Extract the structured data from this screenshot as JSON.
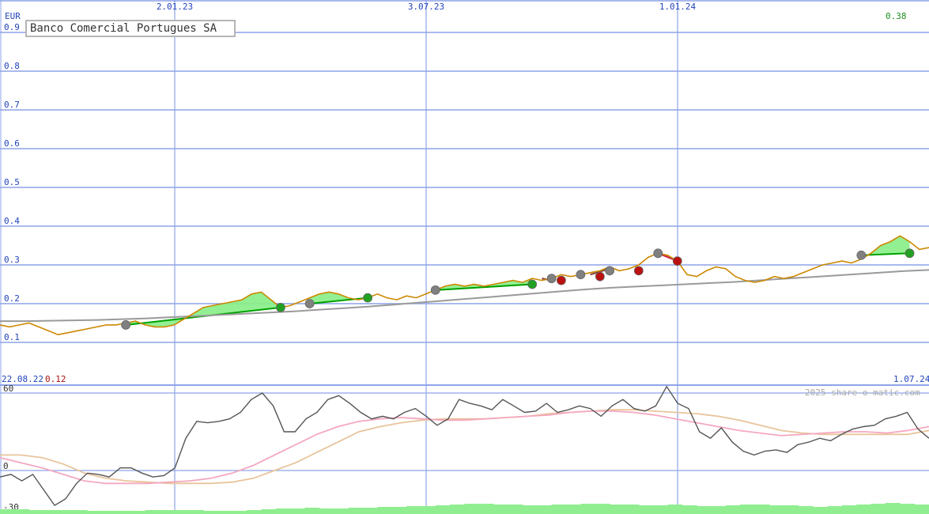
{
  "title": "Banco Comercial Portugues SA",
  "currency": "EUR",
  "last_value": "0.38",
  "watermark": "2025 share-o-matic.com",
  "period": {
    "start": "22.08.22",
    "end": "1.07.24",
    "start_value": "0.12"
  },
  "colors": {
    "grid": "#8ea4e8",
    "price": "#cc8800",
    "long_ma": "#9a9a9a",
    "trend_up": "#00a000",
    "fill_up": "#86ee86",
    "fill_down": "#ff9fb8",
    "marker_grey": "#808080",
    "marker_green": "#22a022",
    "marker_red": "#bb1111",
    "osc": "#555555",
    "osc_pink": "#f4a8c0",
    "osc_tan": "#e8c49c",
    "volume": "#90ee90"
  },
  "chart_data": [
    {
      "type": "line",
      "title": "Banco Comercial Portugues SA",
      "ylabel": "EUR",
      "x_ticks": [
        "2.01.23",
        "3.07.23",
        "1.01.24"
      ],
      "y_ticks": [
        "0.1",
        "0.2",
        "0.3",
        "0.4",
        "0.5",
        "0.6",
        "0.7",
        "0.8",
        "0.9"
      ],
      "ylim": [
        0.09,
        0.93
      ],
      "grid": true,
      "series": [
        {
          "role": "price",
          "values": [
            0.145,
            0.14,
            0.145,
            0.15,
            0.14,
            0.13,
            0.12,
            0.125,
            0.13,
            0.135,
            0.14,
            0.145,
            0.145,
            0.15,
            0.155,
            0.145,
            0.14,
            0.14,
            0.145,
            0.16,
            0.175,
            0.19,
            0.195,
            0.2,
            0.205,
            0.21,
            0.225,
            0.23,
            0.21,
            0.19,
            0.195,
            0.205,
            0.215,
            0.225,
            0.23,
            0.225,
            0.215,
            0.21,
            0.215,
            0.225,
            0.215,
            0.21,
            0.22,
            0.215,
            0.225,
            0.235,
            0.245,
            0.25,
            0.245,
            0.25,
            0.245,
            0.25,
            0.255,
            0.26,
            0.255,
            0.265,
            0.26,
            0.265,
            0.275,
            0.27,
            0.275,
            0.28,
            0.285,
            0.295,
            0.285,
            0.29,
            0.3,
            0.32,
            0.33,
            0.325,
            0.31,
            0.275,
            0.27,
            0.285,
            0.295,
            0.29,
            0.27,
            0.26,
            0.255,
            0.26,
            0.27,
            0.265,
            0.27,
            0.28,
            0.29,
            0.3,
            0.305,
            0.31,
            0.305,
            0.315,
            0.33,
            0.35,
            0.36,
            0.375,
            0.36,
            0.34,
            0.345
          ]
        },
        {
          "role": "long moving average",
          "values": [
            0.155,
            0.155,
            0.156,
            0.157,
            0.158,
            0.16,
            0.162,
            0.165,
            0.168,
            0.171,
            0.174,
            0.177,
            0.18,
            0.184,
            0.188,
            0.192,
            0.197,
            0.202,
            0.207,
            0.212,
            0.217,
            0.222,
            0.227,
            0.232,
            0.237,
            0.241,
            0.244,
            0.247,
            0.25,
            0.253,
            0.256,
            0.26,
            0.264,
            0.268,
            0.272,
            0.276,
            0.28,
            0.284,
            0.287
          ]
        }
      ],
      "trend_segments": [
        {
          "from": 0.145,
          "to": 0.19,
          "dir": "up"
        },
        {
          "from": 0.2,
          "to": 0.215,
          "dir": "up"
        },
        {
          "from": 0.235,
          "to": 0.25,
          "dir": "up"
        },
        {
          "from": 0.265,
          "to": 0.26,
          "dir": "mixed"
        },
        {
          "from": 0.275,
          "to": 0.29,
          "dir": "mixed"
        },
        {
          "from": 0.33,
          "to": 0.31,
          "dir": "down"
        },
        {
          "from": 0.325,
          "to": 0.33,
          "dir": "up"
        }
      ],
      "signals": [
        {
          "y": 0.145,
          "kind": "grey"
        },
        {
          "y": 0.19,
          "kind": "green"
        },
        {
          "y": 0.2,
          "kind": "grey"
        },
        {
          "y": 0.215,
          "kind": "green"
        },
        {
          "y": 0.235,
          "kind": "grey"
        },
        {
          "y": 0.25,
          "kind": "green"
        },
        {
          "y": 0.265,
          "kind": "grey"
        },
        {
          "y": 0.26,
          "kind": "red"
        },
        {
          "y": 0.275,
          "kind": "grey"
        },
        {
          "y": 0.27,
          "kind": "red"
        },
        {
          "y": 0.285,
          "kind": "grey"
        },
        {
          "y": 0.285,
          "kind": "red"
        },
        {
          "y": 0.33,
          "kind": "grey"
        },
        {
          "y": 0.31,
          "kind": "red"
        },
        {
          "y": 0.325,
          "kind": "grey"
        },
        {
          "y": 0.33,
          "kind": "green"
        }
      ]
    },
    {
      "type": "line",
      "y_ticks": [
        "60",
        "0",
        "-30"
      ],
      "ylim": [
        -30,
        60
      ],
      "grid": true,
      "series": [
        {
          "role": "oscillator",
          "values": [
            -5,
            -3,
            -8,
            -3,
            -15,
            -27,
            -22,
            -10,
            -2,
            -3,
            -5,
            2,
            2,
            -2,
            -5,
            -4,
            2,
            25,
            38,
            37,
            38,
            40,
            45,
            55,
            60,
            50,
            30,
            30,
            40,
            45,
            55,
            58,
            52,
            45,
            40,
            42,
            40,
            45,
            48,
            42,
            35,
            40,
            55,
            52,
            50,
            47,
            55,
            50,
            45,
            46,
            52,
            45,
            47,
            50,
            48,
            42,
            50,
            55,
            48,
            46,
            50,
            65,
            52,
            48,
            30,
            25,
            33,
            22,
            15,
            12,
            15,
            16,
            14,
            20,
            22,
            25,
            23,
            28,
            32,
            34,
            35,
            40,
            42,
            45,
            32,
            25
          ]
        },
        {
          "role": "signal line 1",
          "values": [
            10,
            6,
            2,
            -3,
            -8,
            -10,
            -10,
            -10,
            -9,
            -8,
            -6,
            -2,
            4,
            12,
            20,
            28,
            34,
            38,
            40,
            41,
            40,
            39,
            39,
            40,
            41,
            42,
            43,
            45,
            46,
            46,
            45,
            43,
            40,
            37,
            34,
            31,
            29,
            27,
            28,
            29,
            30,
            30,
            29,
            31,
            34
          ]
        },
        {
          "role": "signal line 2",
          "values": [
            12,
            12,
            10,
            5,
            -2,
            -6,
            -8,
            -9,
            -10,
            -10,
            -10,
            -9,
            -6,
            0,
            6,
            14,
            22,
            30,
            34,
            37,
            39,
            40,
            40,
            40,
            41,
            42,
            44,
            45,
            46,
            47,
            47,
            46,
            45,
            44,
            42,
            39,
            35,
            31,
            29,
            28,
            28,
            28,
            28,
            28,
            31
          ]
        }
      ],
      "volume": [
        6,
        6,
        5,
        5,
        5,
        5,
        4,
        4,
        4,
        4,
        5,
        5,
        5,
        5,
        4,
        4,
        4,
        5,
        6,
        7,
        7,
        8,
        7,
        7,
        8,
        8,
        9,
        9,
        10,
        10,
        11,
        12,
        13,
        13,
        12,
        12,
        11,
        11,
        12,
        12,
        13,
        13,
        12,
        12,
        11,
        11,
        12,
        11,
        10,
        10,
        11,
        12,
        12,
        11,
        11,
        10,
        9,
        10,
        11,
        12,
        13,
        14,
        13,
        12
      ]
    }
  ]
}
